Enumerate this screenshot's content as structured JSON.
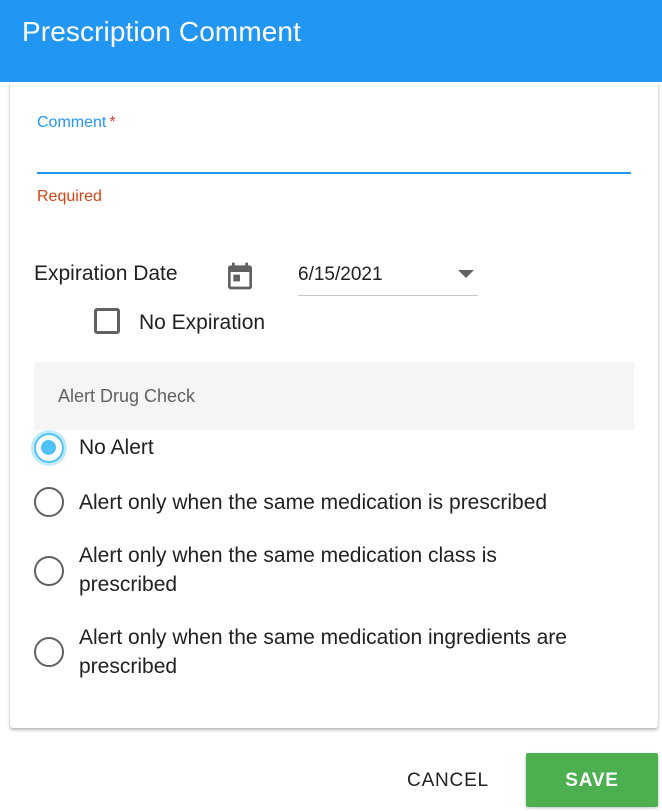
{
  "dialog": {
    "title": "Prescription Comment"
  },
  "comment": {
    "label": "Comment",
    "required_marker": "*",
    "value": "",
    "error": "Required"
  },
  "expiration": {
    "label": "Expiration Date",
    "date_value": "6/15/2021",
    "no_expiration_label": "No Expiration",
    "no_expiration_checked": false
  },
  "alert_drug_check": {
    "title": "Alert Drug Check",
    "selected_index": 0,
    "options": [
      {
        "label": "No Alert"
      },
      {
        "label": "Alert only when the same medication is prescribed"
      },
      {
        "label": "Alert only when the same medication class is prescribed"
      },
      {
        "label": "Alert only when the same medication ingredients are prescribed"
      }
    ]
  },
  "actions": {
    "cancel_label": "CANCEL",
    "save_label": "SAVE"
  },
  "colors": {
    "header": "#2196f3",
    "accent": "#2196f3",
    "error": "#d84315",
    "radio_selected": "#4fc3f7",
    "save": "#4caf50"
  },
  "icons": {
    "date_picker": "calendar-icon",
    "date_dropdown": "caret-down-icon"
  }
}
